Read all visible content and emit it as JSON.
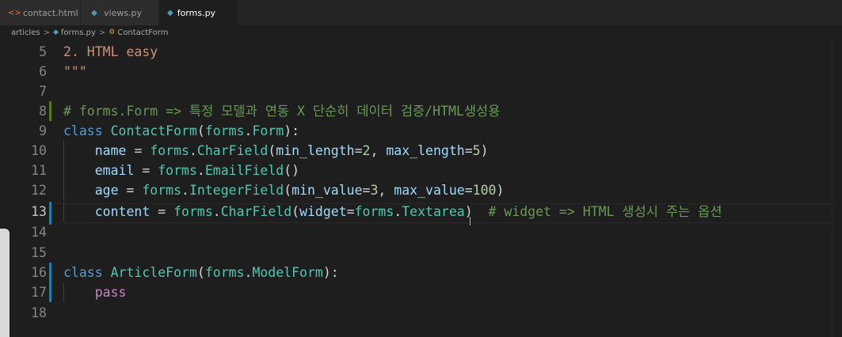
{
  "tabs": [
    {
      "label": "contact.html",
      "icon": "html-file-icon",
      "active": false
    },
    {
      "label": "views.py",
      "icon": "python-file-icon",
      "active": false
    },
    {
      "label": "forms.py",
      "icon": "python-file-icon",
      "active": true,
      "modified": true
    }
  ],
  "breadcrumb": {
    "folder": "articles",
    "file": "forms.py",
    "symbol": "ContactForm"
  },
  "editor": {
    "current_line": 13,
    "lines": [
      {
        "num": "5",
        "text": "2. HTML easy"
      },
      {
        "num": "6",
        "text": "\"\"\""
      },
      {
        "num": "7",
        "text": ""
      },
      {
        "num": "8",
        "text": "# forms.Form => 특정 모델과 연동 X 단순히 데이터 검증/HTML생성용"
      },
      {
        "num": "9",
        "text": "class ContactForm(forms.Form):"
      },
      {
        "num": "10",
        "text": "    name = forms.CharField(min_length=2, max_length=5)"
      },
      {
        "num": "11",
        "text": "    email = forms.EmailField()"
      },
      {
        "num": "12",
        "text": "    age = forms.IntegerField(min_value=3, max_value=100)"
      },
      {
        "num": "13",
        "text": "    content = forms.CharField(widget=forms.Textarea)  # widget => HTML 생성시 주는 옵션"
      },
      {
        "num": "14",
        "text": ""
      },
      {
        "num": "15",
        "text": ""
      },
      {
        "num": "16",
        "text": "class ArticleForm(forms.ModelForm):"
      },
      {
        "num": "17",
        "text": "    pass"
      },
      {
        "num": "18",
        "text": ""
      }
    ]
  },
  "colors": {
    "background": "#1e1e1e",
    "keyword": "#569cd6",
    "class_name": "#4ec9b0",
    "variable": "#9cdcfe",
    "function": "#dcdcaa",
    "number": "#b5cea8",
    "string": "#ce9178",
    "comment": "#6a9955",
    "control": "#c586c0"
  }
}
